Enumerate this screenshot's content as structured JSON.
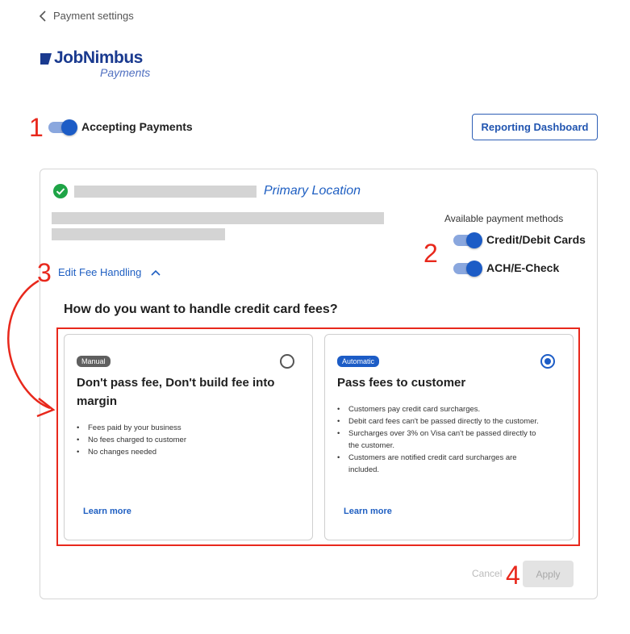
{
  "back_link": {
    "label": "Payment settings"
  },
  "logo": {
    "name": "JobNimbus",
    "sub": "Payments"
  },
  "header": {
    "accepting_label": "Accepting Payments",
    "accepting_on": true,
    "reporting_button": "Reporting Dashboard"
  },
  "annotations": {
    "n1": "1",
    "n2": "2",
    "n3": "3",
    "n4": "4"
  },
  "location": {
    "primary_label": "Primary Location",
    "methods_title": "Available payment methods",
    "methods": [
      {
        "label": "Credit/Debit Cards",
        "enabled": true
      },
      {
        "label": "ACH/E-Check",
        "enabled": true
      }
    ],
    "edit_fee_label": "Edit Fee Handling"
  },
  "fees": {
    "question": "How do you want to handle credit card fees?",
    "options": [
      {
        "badge": "Manual",
        "title": "Don't pass fee, Don't build fee into margin",
        "selected": false,
        "bullets": [
          "Fees paid by your business",
          "No fees charged to customer",
          "No changes needed"
        ],
        "learn_more": "Learn more"
      },
      {
        "badge": "Automatic",
        "title": "Pass fees to customer",
        "selected": true,
        "bullets": [
          "Customers pay credit card surcharges.",
          "Debit card fees can't be passed directly to the customer.",
          "Surcharges over 3% on Visa can't be passed directly to the customer.",
          "Customers are notified credit card surcharges are included."
        ],
        "learn_more": "Learn more"
      }
    ]
  },
  "actions": {
    "cancel": "Cancel",
    "apply": "Apply"
  },
  "colors": {
    "accent": "#1c5cc6",
    "annotation": "#e8281c",
    "success": "#1ea446"
  }
}
